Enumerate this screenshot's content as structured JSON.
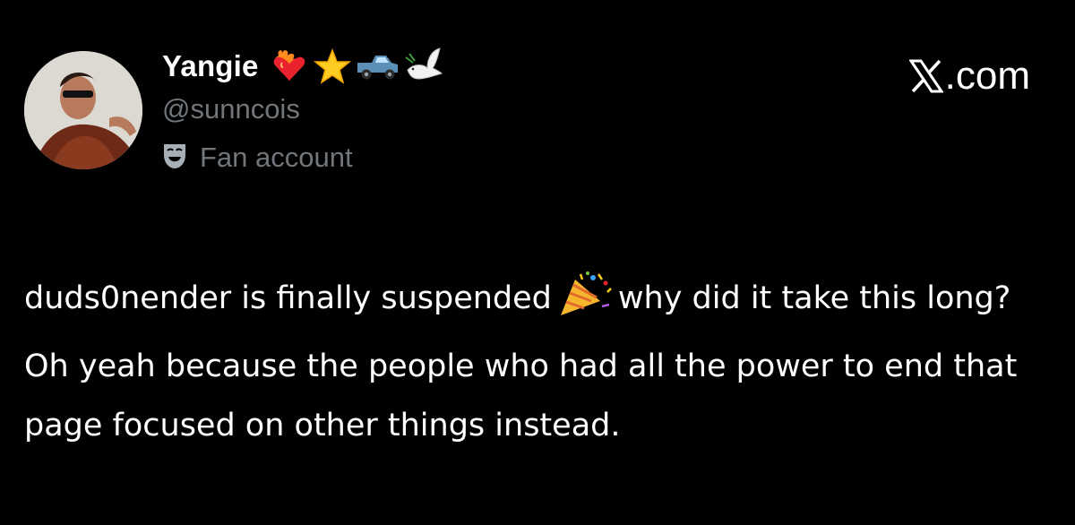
{
  "profile": {
    "display_name": "Yangie",
    "handle": "@sunncois",
    "label": "Fan account",
    "label_icon": "theater-masks-icon",
    "badges": [
      "heart-on-fire-icon",
      "star-icon",
      "pickup-truck-icon",
      "dove-icon"
    ]
  },
  "brand": {
    "text": ".com",
    "icon": "x-logo-icon"
  },
  "post": {
    "text_part1": "duds0nender is finally suspended",
    "emoji": "party-popper-icon",
    "text_part2": "why did it take this long? Oh yeah because the people who had all the power to end that page focused on other things instead."
  },
  "colors": {
    "background": "#000000",
    "primary_text": "#ffffff",
    "secondary_text": "#71767b"
  }
}
